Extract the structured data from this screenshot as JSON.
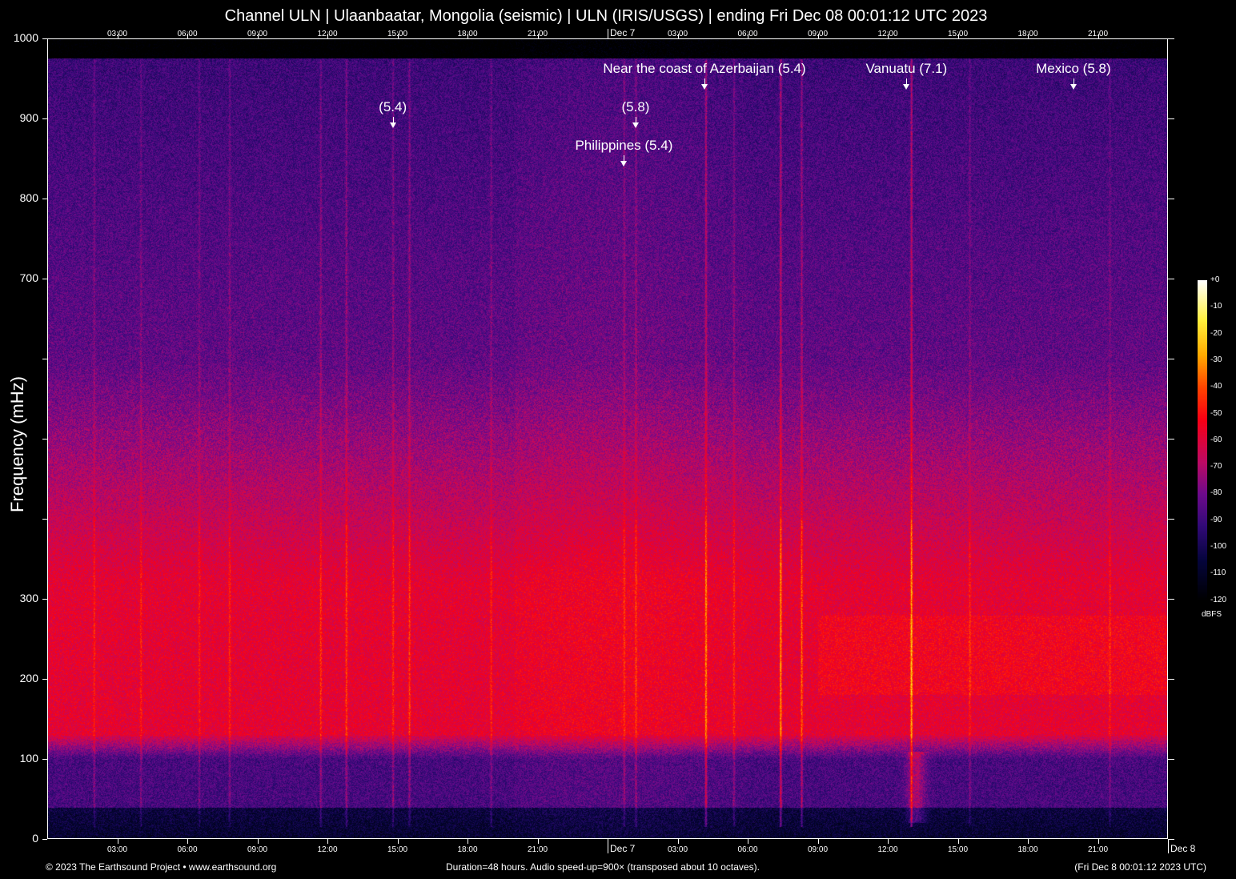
{
  "chart_data": {
    "type": "heatmap",
    "title": "Channel ULN | Ulaanbaatar, Mongolia (seismic) | ULN (IRIS/USGS) | ending Fri Dec 08 00:01:12 UTC 2023",
    "ylabel": "Frequency (mHz)",
    "xlabel": "",
    "xlim_hours": [
      0,
      48
    ],
    "ylim": [
      0,
      1000
    ],
    "yticks": [
      {
        "v": 0,
        "label": "0"
      },
      {
        "v": 100,
        "label": "100"
      },
      {
        "v": 200,
        "label": "200"
      },
      {
        "v": 300,
        "label": "300"
      },
      {
        "v": 400,
        "label": ""
      },
      {
        "v": 500,
        "label": ""
      },
      {
        "v": 600,
        "label": ""
      },
      {
        "v": 700,
        "label": "700"
      },
      {
        "v": 800,
        "label": "800"
      },
      {
        "v": 900,
        "label": "900"
      },
      {
        "v": 1000,
        "label": "1000"
      }
    ],
    "xticks": [
      {
        "h": 3,
        "label": "03:00"
      },
      {
        "h": 6,
        "label": "06:00"
      },
      {
        "h": 9,
        "label": "09:00"
      },
      {
        "h": 12,
        "label": "12:00"
      },
      {
        "h": 15,
        "label": "15:00"
      },
      {
        "h": 18,
        "label": "18:00"
      },
      {
        "h": 21,
        "label": "21:00"
      },
      {
        "h": 27,
        "label": "03:00"
      },
      {
        "h": 30,
        "label": "06:00"
      },
      {
        "h": 33,
        "label": "09:00"
      },
      {
        "h": 36,
        "label": "12:00"
      },
      {
        "h": 39,
        "label": "15:00"
      },
      {
        "h": 42,
        "label": "18:00"
      },
      {
        "h": 45,
        "label": "21:00"
      }
    ],
    "day_markers": [
      {
        "h": 24,
        "label": "Dec  7"
      },
      {
        "h": 48,
        "label": "Dec  8"
      }
    ],
    "events": [
      {
        "label": "(5.4)",
        "h": 14.8,
        "freq": 888
      },
      {
        "label": "(5.8)",
        "h": 25.2,
        "freq": 888
      },
      {
        "label": "Philippines (5.4)",
        "h": 24.7,
        "freq": 840
      },
      {
        "label": "Near the coast of Azerbaijan (5.4)",
        "h": 28.15,
        "freq": 936
      },
      {
        "label": "Vanuatu (7.1)",
        "h": 36.8,
        "freq": 936
      },
      {
        "label": "Mexico (5.8)",
        "h": 43.95,
        "freq": 936
      }
    ],
    "colorbar": {
      "unit": "dBFS",
      "range": [
        -120,
        0
      ],
      "ticks": [
        "+0",
        "-10",
        "-20",
        "-30",
        "-40",
        "-50",
        "-60",
        "-70",
        "-80",
        "-90",
        "-100",
        "-110",
        "-120"
      ]
    }
  },
  "footer": {
    "copyright": "© 2023 The Earthsound Project • www.earthsound.org",
    "duration": "Duration=48 hours. Audio speed-up=900× (transposed about 10 octaves).",
    "end_time": "(Fri Dec  8 00:01:12 2023 UTC)"
  }
}
